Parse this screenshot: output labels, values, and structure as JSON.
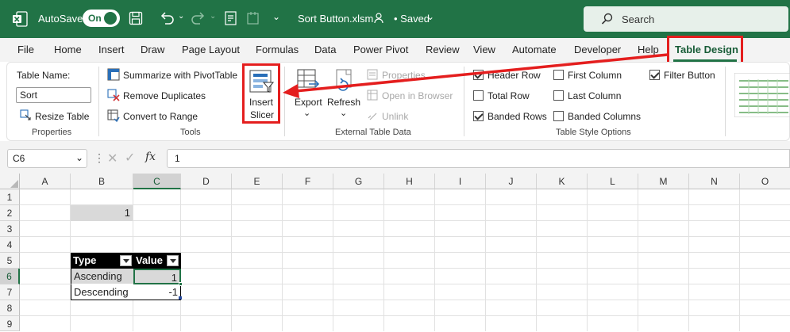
{
  "titlebar": {
    "autosave_label": "AutoSave",
    "toggle_state": "On",
    "filename": "Sort Button.xlsm",
    "saved_status": "• Saved",
    "search_placeholder": "Search"
  },
  "tabs": [
    "File",
    "Home",
    "Insert",
    "Draw",
    "Page Layout",
    "Formulas",
    "Data",
    "Power Pivot",
    "Review",
    "View",
    "Automate",
    "Developer",
    "Help",
    "Table Design"
  ],
  "active_tab": "Table Design",
  "ribbon": {
    "properties": {
      "group_label": "Properties",
      "table_name_label": "Table Name:",
      "table_name_value": "Sort",
      "resize_table": "Resize Table"
    },
    "tools": {
      "group_label": "Tools",
      "summarize": "Summarize with PivotTable",
      "remove_duplicates": "Remove Duplicates",
      "convert_to_range": "Convert to Range",
      "insert_slicer_line1": "Insert",
      "insert_slicer_line2": "Slicer"
    },
    "external": {
      "group_label": "External Table Data",
      "export": "Export",
      "refresh": "Refresh",
      "properties": "Properties",
      "open_in_browser": "Open in Browser",
      "unlink": "Unlink"
    },
    "style_options": {
      "group_label": "Table Style Options",
      "header_row": "Header Row",
      "first_column": "First Column",
      "filter_button": "Filter Button",
      "total_row": "Total Row",
      "last_column": "Last Column",
      "banded_rows": "Banded Rows",
      "banded_columns": "Banded Columns",
      "checked": {
        "header_row": true,
        "first_column": false,
        "filter_button": true,
        "total_row": false,
        "last_column": false,
        "banded_rows": true,
        "banded_columns": false
      }
    }
  },
  "formula_bar": {
    "name_box": "C6",
    "fx": "fx",
    "formula": "1"
  },
  "sheet": {
    "columns": [
      "A",
      "B",
      "C",
      "D",
      "E",
      "F",
      "G",
      "H",
      "I",
      "J",
      "K",
      "L",
      "M",
      "N",
      "O"
    ],
    "rows": [
      "1",
      "2",
      "3",
      "4",
      "5",
      "6",
      "7",
      "8",
      "9"
    ],
    "b2_value": "1",
    "table_headers": [
      "Type",
      "Value"
    ],
    "table_rows": [
      [
        "Ascending",
        "1"
      ],
      [
        "Descending",
        "-1"
      ]
    ]
  },
  "colors": {
    "excel_green": "#217346",
    "highlight_red": "#e41e1e",
    "table_header_bg": "#000000"
  }
}
